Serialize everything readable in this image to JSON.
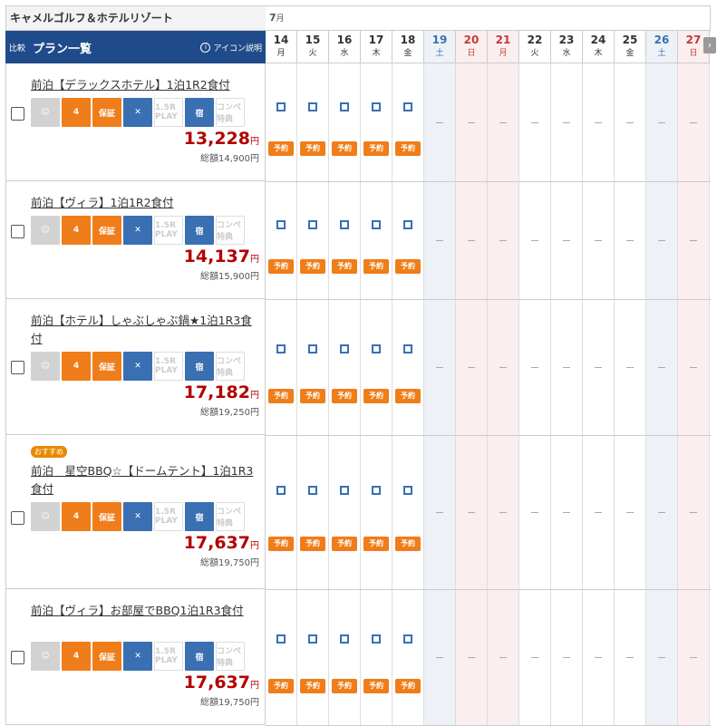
{
  "course_title": "キャメルゴルフ＆ホテルリゾート",
  "month": {
    "num": "7",
    "suffix": "月"
  },
  "plan_header": {
    "compare": "比較",
    "label": "プラン一覧",
    "icon_help": "アイコン説明"
  },
  "days": [
    {
      "d": "14",
      "w": "月",
      "type": "weekday"
    },
    {
      "d": "15",
      "w": "火",
      "type": "weekday"
    },
    {
      "d": "16",
      "w": "水",
      "type": "weekday"
    },
    {
      "d": "17",
      "w": "木",
      "type": "weekday"
    },
    {
      "d": "18",
      "w": "金",
      "type": "weekday"
    },
    {
      "d": "19",
      "w": "土",
      "type": "sat"
    },
    {
      "d": "20",
      "w": "日",
      "type": "sun"
    },
    {
      "d": "21",
      "w": "月",
      "type": "sun"
    },
    {
      "d": "22",
      "w": "火",
      "type": "weekday"
    },
    {
      "d": "23",
      "w": "水",
      "type": "weekday"
    },
    {
      "d": "24",
      "w": "木",
      "type": "weekday"
    },
    {
      "d": "25",
      "w": "金",
      "type": "weekday"
    },
    {
      "d": "26",
      "w": "土",
      "type": "sat"
    },
    {
      "d": "27",
      "w": "日",
      "type": "sun"
    }
  ],
  "reserve_label": "予約",
  "unavailable_mark": "－",
  "icon_labels": {
    "cart": "4",
    "guarantee": "保証",
    "play": "1.5R PLAY",
    "stay": "宿",
    "compe": "コンペ特典"
  },
  "plans": [
    {
      "name": "前泊【デラックスホテル】1泊1R2食付",
      "price": "13,228",
      "yen": "円",
      "total": "総額14,900円",
      "badge": "",
      "available_days": 5,
      "icons": [
        "grey",
        "orange",
        "orange",
        "blue",
        "ghost",
        "blue",
        "ghost"
      ]
    },
    {
      "name": "前泊【ヴィラ】1泊1R2食付",
      "price": "14,137",
      "yen": "円",
      "total": "総額15,900円",
      "badge": "",
      "available_days": 5,
      "icons": [
        "grey",
        "orange",
        "orange",
        "blue",
        "ghost",
        "blue",
        "ghost"
      ]
    },
    {
      "name": "前泊【ホテル】しゃぶしゃぶ鍋★1泊1R3食付",
      "price": "17,182",
      "yen": "円",
      "total": "総額19,250円",
      "badge": "",
      "available_days": 5,
      "icons": [
        "grey",
        "orange",
        "orange",
        "blue",
        "ghost",
        "blue",
        "ghost"
      ]
    },
    {
      "name": "前泊　星空BBQ☆【ドームテント】1泊1R3食付",
      "price": "17,637",
      "yen": "円",
      "total": "総額19,750円",
      "badge": "おすすめ",
      "available_days": 5,
      "icons": [
        "grey",
        "orange",
        "orange",
        "blue",
        "ghost",
        "blue",
        "ghost"
      ]
    },
    {
      "name": "前泊【ヴィラ】お部屋でBBQ1泊1R3食付",
      "price": "17,637",
      "yen": "円",
      "total": "総額19,750円",
      "badge": "",
      "available_days": 5,
      "icons": [
        "grey",
        "orange",
        "orange",
        "blue",
        "ghost",
        "blue",
        "ghost"
      ]
    }
  ]
}
